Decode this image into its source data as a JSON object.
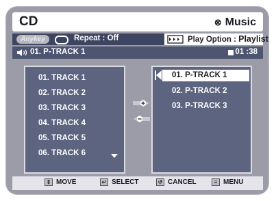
{
  "header": {
    "source": "CD",
    "mode_icon": "music-note-icon",
    "mode": "Music"
  },
  "options": {
    "anykey_label": "Anykey",
    "repeat_label": "Repeat : Off",
    "play_option_label": "Play Option : ",
    "play_option_value": "Playlist"
  },
  "now_playing": {
    "track": "01. P-TRACK 1",
    "time": "01 :38"
  },
  "track_list": [
    "01. TRACK 1",
    "02. TRACK 2",
    "03. TRACK 3",
    "04. TRACK 4",
    "05. TRACK 5",
    "06. TRACK 6"
  ],
  "playlist": [
    "01. P-TRACK 1",
    "02. P-TRACK 2",
    "03. P-TRACK 3"
  ],
  "footer": {
    "move": "MOVE",
    "select": "SELECT",
    "cancel": "CANCEL",
    "menu": "MENU"
  },
  "colors": {
    "frame": "#9c9ca8",
    "panel": "#5c6480",
    "option_bar": "#3d4561",
    "now_bar": "#4d5570",
    "footer": "#e4e4ea"
  }
}
